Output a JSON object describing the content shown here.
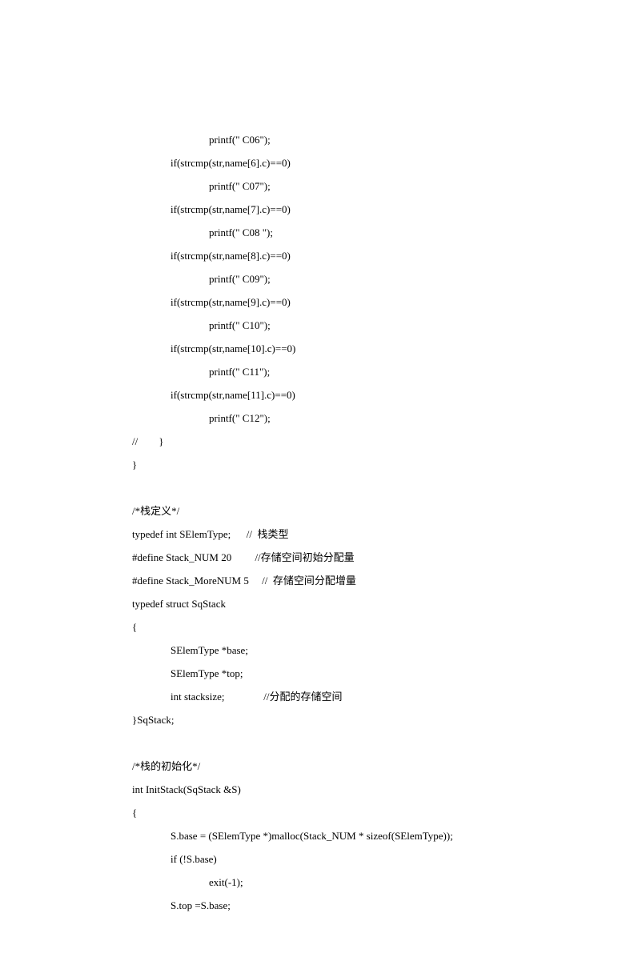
{
  "lines": [
    {
      "cls": "i1",
      "text": "printf(\" C06\");"
    },
    {
      "cls": "i2",
      "text": "if(strcmp(str,name[6].c)==0)"
    },
    {
      "cls": "i1",
      "text": "printf(\" C07\");"
    },
    {
      "cls": "i2",
      "text": "if(strcmp(str,name[7].c)==0)"
    },
    {
      "cls": "i1",
      "text": "printf(\" C08 \");"
    },
    {
      "cls": "i2",
      "text": "if(strcmp(str,name[8].c)==0)"
    },
    {
      "cls": "i1",
      "text": "printf(\" C09\");"
    },
    {
      "cls": "i2",
      "text": "if(strcmp(str,name[9].c)==0)"
    },
    {
      "cls": "i1",
      "text": "printf(\" C10\");"
    },
    {
      "cls": "i2",
      "text": "if(strcmp(str,name[10].c)==0)"
    },
    {
      "cls": "i1",
      "text": "printf(\" C11\");"
    },
    {
      "cls": "i2",
      "text": "if(strcmp(str,name[11].c)==0)"
    },
    {
      "cls": "i1",
      "text": "printf(\" C12\");"
    },
    {
      "cls": "i3",
      "text": "//        }"
    },
    {
      "cls": "i3",
      "text": "}"
    },
    {
      "cls": "blank",
      "text": ""
    },
    {
      "cls": "i3",
      "text": "/*栈定义*/"
    },
    {
      "cls": "i3",
      "text": "typedef int SElemType;      //  栈类型"
    },
    {
      "cls": "i3",
      "text": "#define Stack_NUM 20         //存储空间初始分配量"
    },
    {
      "cls": "i3",
      "text": "#define Stack_MoreNUM 5     //  存储空间分配增量"
    },
    {
      "cls": "i3",
      "text": "typedef struct SqStack"
    },
    {
      "cls": "i3",
      "text": "{"
    },
    {
      "cls": "i4",
      "text": "SElemType *base;"
    },
    {
      "cls": "i4",
      "text": "SElemType *top;"
    },
    {
      "cls": "i4",
      "text": "int stacksize;               //分配的存储空间"
    },
    {
      "cls": "i3",
      "text": "}SqStack;"
    },
    {
      "cls": "blank",
      "text": ""
    },
    {
      "cls": "i3",
      "text": "/*栈的初始化*/"
    },
    {
      "cls": "i3",
      "text": "int InitStack(SqStack &S)"
    },
    {
      "cls": "i3",
      "text": "{"
    },
    {
      "cls": "i4",
      "text": "S.base = (SElemType *)malloc(Stack_NUM * sizeof(SElemType));"
    },
    {
      "cls": "i4",
      "text": "if (!S.base)"
    },
    {
      "cls": "i1",
      "text": "exit(-1);"
    },
    {
      "cls": "i4",
      "text": "S.top =S.base;"
    }
  ]
}
